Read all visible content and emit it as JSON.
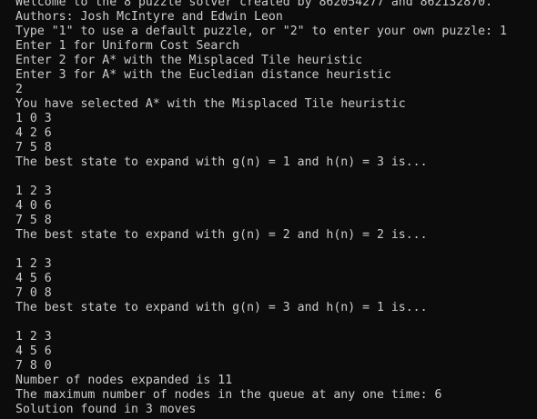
{
  "console": {
    "lines": [
      "Welcome to the 8 puzzle solver created by 862054277 and 862132870.",
      "Authors: Josh McIntyre and Edwin Leon",
      "Type \"1\" to use a default puzzle, or \"2\" to enter your own puzzle: 1",
      "Enter 1 for Uniform Cost Search",
      "Enter 2 for A* with the Misplaced Tile heuristic",
      "Enter 3 for A* with the Eucledian distance heuristic",
      "2",
      "You have selected A* with the Misplaced Tile heuristic",
      "1 0 3",
      "4 2 6",
      "7 5 8",
      "The best state to expand with g(n) = 1 and h(n) = 3 is...",
      "",
      "1 2 3",
      "4 0 6",
      "7 5 8",
      "The best state to expand with g(n) = 2 and h(n) = 2 is...",
      "",
      "1 2 3",
      "4 5 6",
      "7 0 8",
      "The best state to expand with g(n) = 3 and h(n) = 1 is...",
      "",
      "1 2 3",
      "4 5 6",
      "7 8 0",
      "Number of nodes expanded is 11",
      "The maximum number of nodes in the queue at any one time: 6",
      "Solution found in 3 moves"
    ]
  }
}
